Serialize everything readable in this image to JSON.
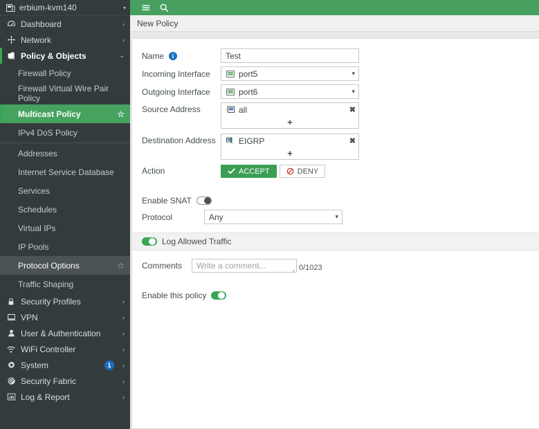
{
  "sidebar": {
    "device": {
      "name": "erbium-kvm140",
      "icon": "device-icon",
      "caret": "▾"
    },
    "items": [
      {
        "label": "Dashboard",
        "icon": "dashboard-icon",
        "arrow": "›",
        "type": "top",
        "state": "collapsed"
      },
      {
        "label": "Network",
        "icon": "network-icon",
        "arrow": "›",
        "type": "top",
        "state": "collapsed"
      },
      {
        "label": "Policy & Objects",
        "icon": "policy-icon",
        "arrow": "⌄",
        "type": "top",
        "state": "expanded"
      },
      {
        "label": "Firewall Policy",
        "type": "sub",
        "state": "normal"
      },
      {
        "label": "Firewall Virtual Wire Pair Policy",
        "type": "sub",
        "state": "normal"
      },
      {
        "label": "Multicast Policy",
        "type": "sub",
        "state": "selected",
        "star": "☆"
      },
      {
        "label": "IPv4 DoS Policy",
        "type": "sub",
        "state": "normal"
      },
      {
        "label": "separator",
        "type": "separator"
      },
      {
        "label": "Addresses",
        "type": "sub",
        "state": "normal"
      },
      {
        "label": "Internet Service Database",
        "type": "sub",
        "state": "normal"
      },
      {
        "label": "Services",
        "type": "sub",
        "state": "normal"
      },
      {
        "label": "Schedules",
        "type": "sub",
        "state": "normal"
      },
      {
        "label": "Virtual IPs",
        "type": "sub",
        "state": "normal"
      },
      {
        "label": "IP Pools",
        "type": "sub",
        "state": "normal"
      },
      {
        "label": "Protocol Options",
        "type": "sub",
        "state": "hovered",
        "star": "☆"
      },
      {
        "label": "Traffic Shaping",
        "type": "sub",
        "state": "normal"
      },
      {
        "label": "Security Profiles",
        "icon": "lock-icon",
        "arrow": "›",
        "type": "top",
        "state": "collapsed"
      },
      {
        "label": "VPN",
        "icon": "vpn-icon",
        "arrow": "›",
        "type": "top",
        "state": "collapsed"
      },
      {
        "label": "User & Authentication",
        "icon": "user-icon",
        "arrow": "›",
        "type": "top",
        "state": "collapsed"
      },
      {
        "label": "WiFi Controller",
        "icon": "wifi-icon",
        "arrow": "›",
        "type": "top",
        "state": "collapsed"
      },
      {
        "label": "System",
        "icon": "gear-icon",
        "arrow": "›",
        "type": "top",
        "state": "collapsed",
        "badge": "1"
      },
      {
        "label": "Security Fabric",
        "icon": "fabric-icon",
        "arrow": "›",
        "type": "top",
        "state": "collapsed"
      },
      {
        "label": "Log & Report",
        "icon": "chart-icon",
        "arrow": "›",
        "type": "top",
        "state": "collapsed"
      }
    ]
  },
  "topbar": {
    "menu_icon": "hamburger-icon",
    "search_icon": "search-icon"
  },
  "breadcrumb": {
    "title": "New Policy"
  },
  "form": {
    "name": {
      "label": "Name",
      "info_icon": "info-icon",
      "value": "Test"
    },
    "incoming_interface": {
      "label": "Incoming Interface",
      "value": "port5",
      "icon": "interface-icon",
      "caret": "▾"
    },
    "outgoing_interface": {
      "label": "Outgoing Interface",
      "value": "port6",
      "icon": "interface-icon",
      "caret": "▾"
    },
    "source_address": {
      "label": "Source Address",
      "entries": [
        {
          "name": "all",
          "icon": "address-subnet-icon",
          "remove": "✖"
        }
      ],
      "add": "+"
    },
    "destination_address": {
      "label": "Destination Address",
      "entries": [
        {
          "name": "EIGRP",
          "icon": "multicast-address-icon",
          "remove": "✖"
        }
      ],
      "add": "+"
    },
    "action": {
      "label": "Action",
      "options": [
        {
          "label": "ACCEPT",
          "icon": "check-icon",
          "selected": true
        },
        {
          "label": "DENY",
          "icon": "deny-icon",
          "selected": false
        }
      ]
    },
    "enable_snat": {
      "label": "Enable SNAT",
      "state": "off"
    },
    "protocol": {
      "label": "Protocol",
      "value": "Any",
      "caret": "▾"
    },
    "log_allowed_traffic": {
      "label": "Log Allowed Traffic",
      "state": "on"
    },
    "comments": {
      "label": "Comments",
      "placeholder": "Write a comment...",
      "value": "",
      "counter": "0/1023"
    },
    "enable_policy": {
      "label": "Enable this policy",
      "state": "on"
    }
  },
  "colors": {
    "brand_green": "#47a05f",
    "accent_green": "#36a853",
    "sidebar_bg": "#333b3d",
    "selected_nav": "#46a35f",
    "badge_blue": "#1b6ec2",
    "deny_red": "#d0342c"
  }
}
